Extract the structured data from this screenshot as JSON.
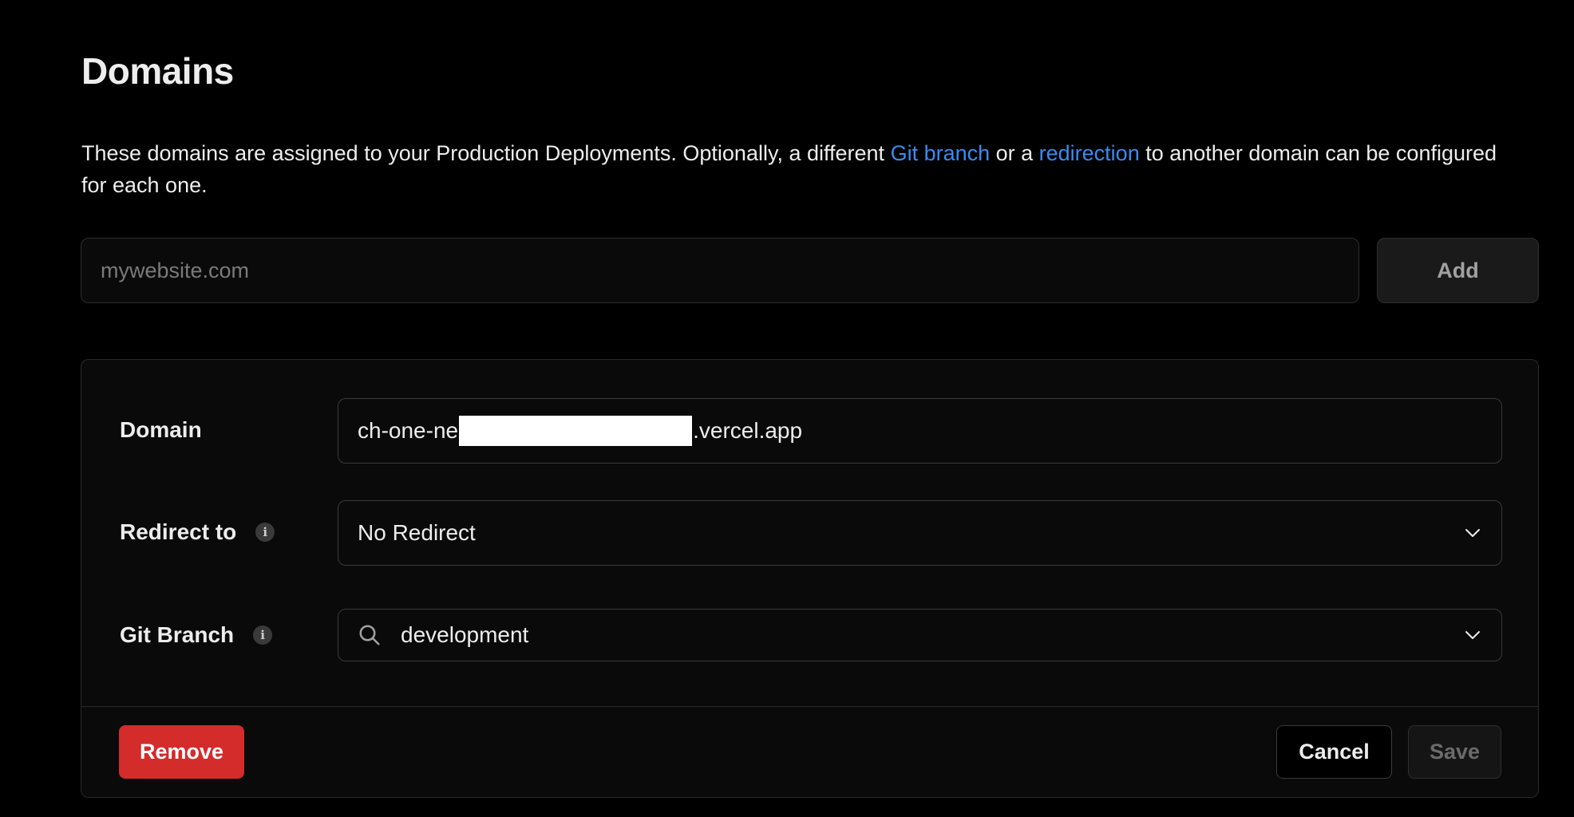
{
  "page": {
    "title": "Domains",
    "description": {
      "part1": "These domains are assigned to your Production Deployments. Optionally, a different ",
      "link1": "Git branch",
      "part2": " or a ",
      "link2": "redirection",
      "part3": " to another domain can be configured for each one."
    }
  },
  "add_domain": {
    "placeholder": "mywebsite.com",
    "value": "",
    "add_label": "Add"
  },
  "domain_card": {
    "domain": {
      "label": "Domain",
      "value_prefix": "ch-one-ne",
      "value_suffix": ".vercel.app"
    },
    "redirect": {
      "label": "Redirect to",
      "value": "No Redirect",
      "info_icon": "info-icon"
    },
    "git_branch": {
      "label": "Git Branch",
      "value": "development",
      "info_icon": "info-icon",
      "search_icon": "search-icon"
    },
    "footer": {
      "remove_label": "Remove",
      "cancel_label": "Cancel",
      "save_label": "Save"
    }
  },
  "colors": {
    "background": "#000000",
    "link": "#3b8bf0",
    "danger": "#d42b2b",
    "card_bg": "#0a0a0a",
    "border": "#2e2e2e"
  }
}
